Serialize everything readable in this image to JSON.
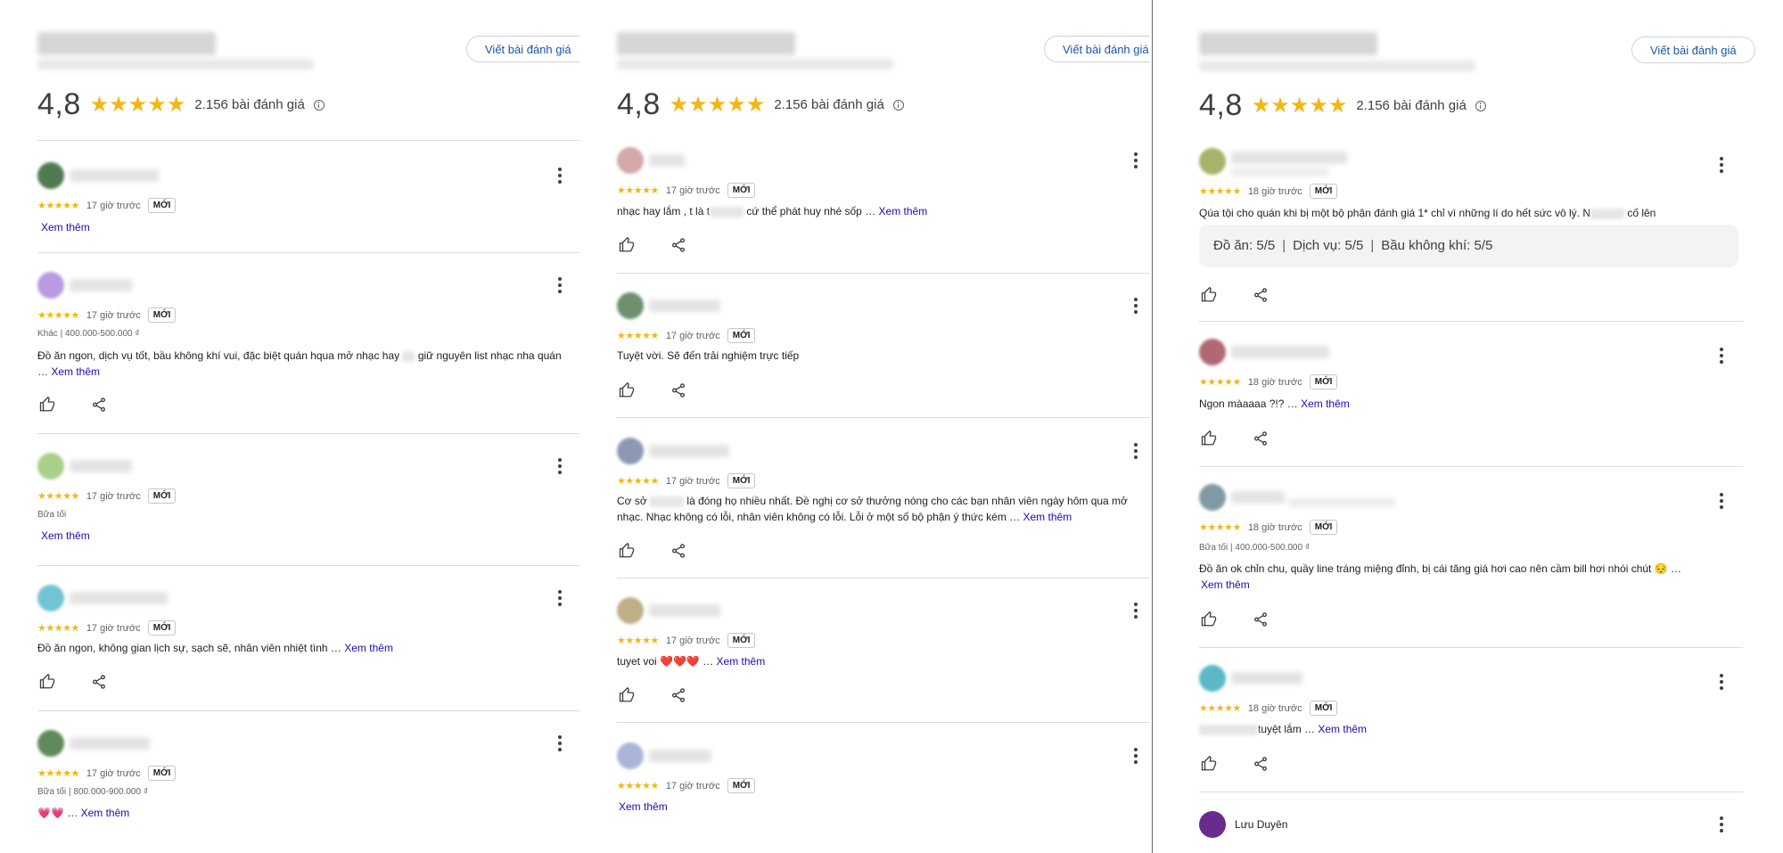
{
  "header": {
    "write_review": "Viết bài đánh giá",
    "score": "4,8",
    "stars": "★★★★★",
    "review_count": "2.156 bài đánh giá"
  },
  "labels": {
    "new": "MỚI",
    "see_more": "Xem thêm",
    "stars": "★★★★★"
  },
  "colors": {
    "star": "#f2b713",
    "link": "#1a0dab",
    "button_text": "#1a56a8"
  },
  "panel1": {
    "reviews": [
      {
        "time": "17 giờ trước",
        "tag": "",
        "text": ""
      },
      {
        "time": "17 giờ trước",
        "tag": "Khác  |  400.000-500.000 ₫",
        "text_a": "Đồ ăn ngon, dịch vụ tốt, bầu không khí vui, đặc biệt quán hqua mở nhạc hay ",
        "text_b": " giữ nguyên list nhạc nha quán … "
      },
      {
        "time": "17 giờ trước",
        "tag": "Bữa tối",
        "text": ""
      },
      {
        "time": "17 giờ trước",
        "tag": "",
        "text": "Đồ ăn ngon, không gian lịch sự, sạch sẽ, nhân viên nhiệt tình … "
      },
      {
        "time": "17 giờ trước",
        "tag": "Bữa tối  |  800.000-900.000 ₫",
        "text": "💗💗 … "
      }
    ]
  },
  "panel2": {
    "reviews": [
      {
        "time": "17 giờ trước",
        "text_a": "nhạc hay lắm , t là t",
        "text_b": " cứ thể phát huy nhé sốp … "
      },
      {
        "time": "17 giờ trước",
        "text": "Tuyệt vời. Sẽ đến trải nghiệm trực tiếp"
      },
      {
        "time": "17 giờ trước",
        "text_a": "Cơ sở ",
        "text_b": " là đóng họ nhiều nhất. Đề nghị cơ sở thưởng nóng cho các bạn nhân viên ngày hôm qua mở nhạc. Nhạc không có lỗi, nhân viên không có lỗi. Lỗi ở một số bộ phận ý thức kém … "
      },
      {
        "time": "17 giờ trước",
        "text": "tuyet voi ❤️❤️❤️ … "
      },
      {
        "time": "17 giờ trước",
        "text": ""
      }
    ]
  },
  "panel3": {
    "reviews": [
      {
        "time": "18 giờ trước",
        "sub": "1 bài đánh giá · 2 ảnh",
        "text_a": "Qúa tội cho quán khi bị một bộ phận đánh giá 1* chỉ vì những lí do hết sức vô lý. N",
        "text_b": " cố lên",
        "aspects": [
          "Đồ ăn: 5/5",
          "Dịch vụ: 5/5",
          "Bầu không khí: 5/5"
        ]
      },
      {
        "time": "18 giờ trước",
        "text": "Ngon màaaaa ?!? … "
      },
      {
        "time": "18 giờ trước",
        "tag": "Bữa tối  |  400.000-500.000 ₫",
        "text": "Đồ ăn ok chỉn chu, quầy line tráng miệng đỉnh, bị cái tăng giá hơi cao nên cầm bill hơi nhói chút 😔 … "
      },
      {
        "time": "18 giờ trước",
        "text": "tuyệt lắm … "
      }
    ],
    "last_reviewer": "Lưu Duyên"
  }
}
